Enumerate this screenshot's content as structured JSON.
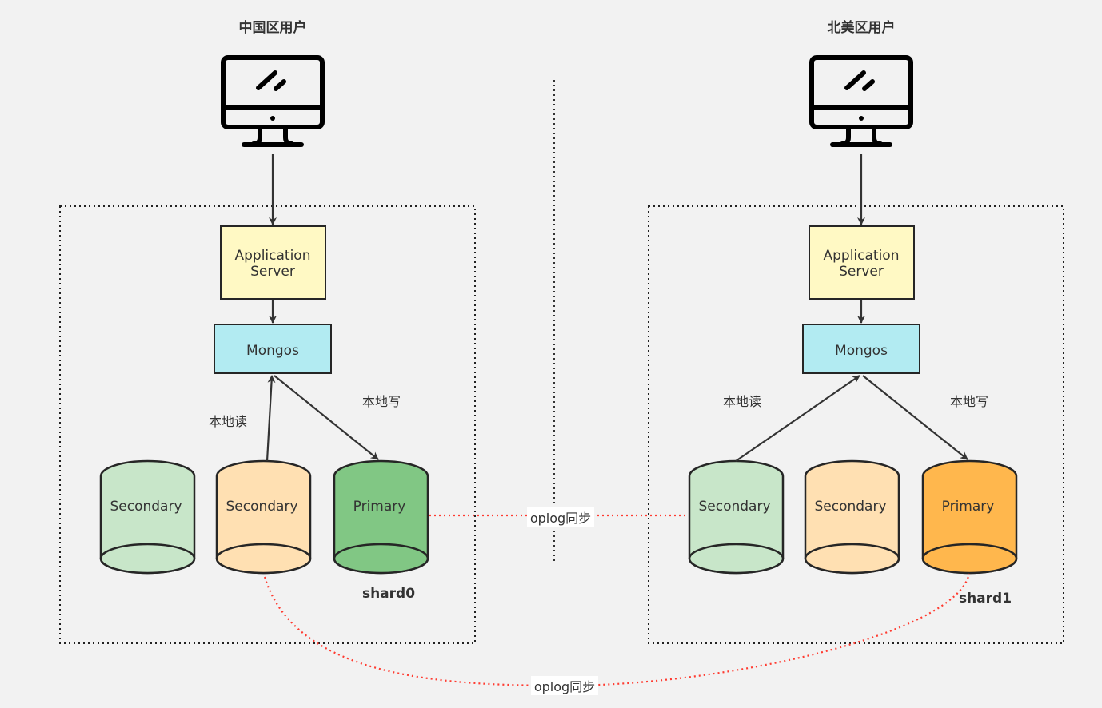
{
  "regions": [
    {
      "title": "中国区用户",
      "app_server": [
        "Application",
        "Server"
      ],
      "mongos": "Mongos",
      "read_label": "本地读",
      "write_label": "本地写",
      "shard_label": "shard0",
      "nodes": [
        {
          "label": "Secondary",
          "color": "#c8e6c9"
        },
        {
          "label": "Secondary",
          "color": "#ffe0b2"
        },
        {
          "label": "Primary",
          "color": "#81c784"
        }
      ]
    },
    {
      "title": "北美区用户",
      "app_server": [
        "Application",
        "Server"
      ],
      "mongos": "Mongos",
      "read_label": "本地读",
      "write_label": "本地写",
      "shard_label": "shard1",
      "nodes": [
        {
          "label": "Secondary",
          "color": "#c8e6c9"
        },
        {
          "label": "Secondary",
          "color": "#ffe0b2"
        },
        {
          "label": "Primary",
          "color": "#ffb74d"
        }
      ]
    }
  ],
  "sync_labels": [
    "oplog同步",
    "oplog同步"
  ],
  "colors": {
    "app_server": "#fff9c4",
    "mongos": "#b2ebf2",
    "sync_line": "#ff3b30",
    "stroke": "#262626"
  }
}
